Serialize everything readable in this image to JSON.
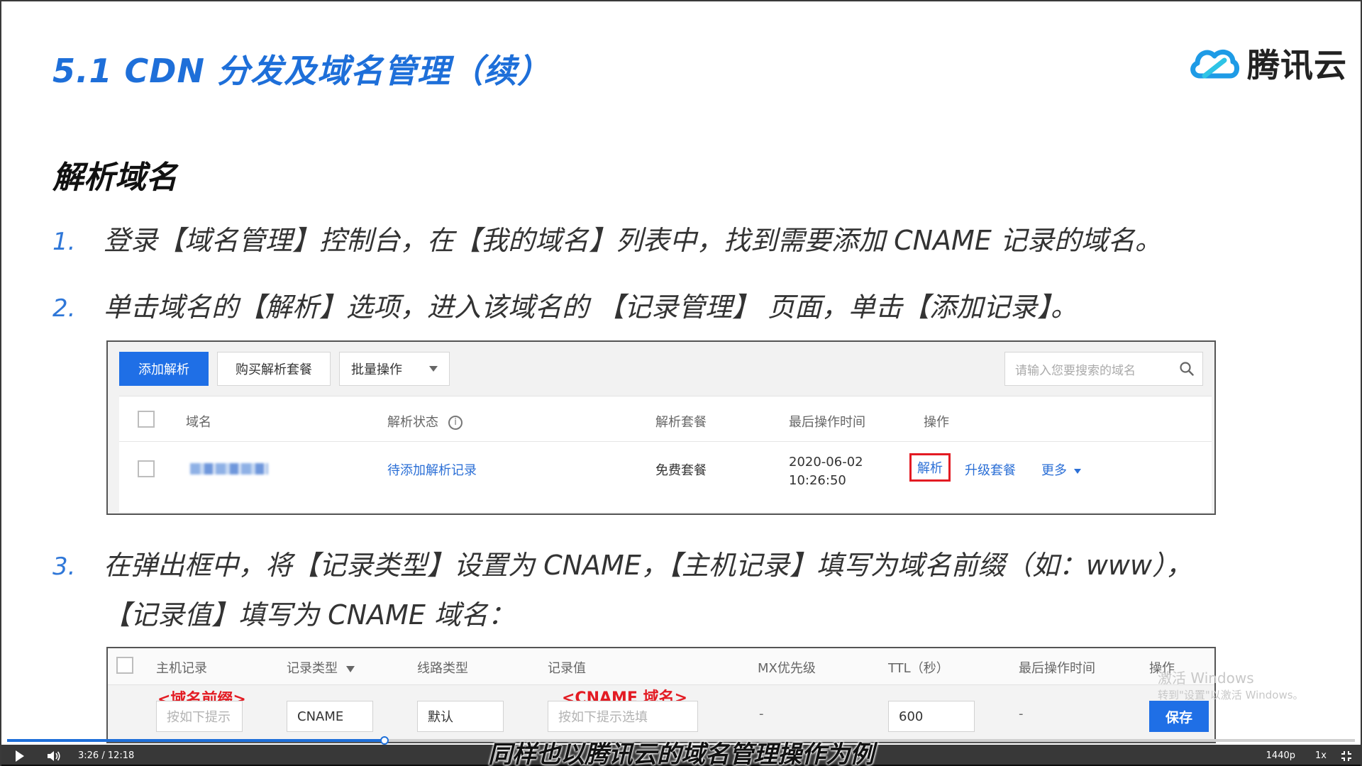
{
  "slide": {
    "title": "5.1 CDN 分发及域名管理（续）",
    "logo_text": "腾讯云",
    "section": "解析域名",
    "steps": [
      {
        "num": "1.",
        "text": "登录【域名管理】控制台，在【我的域名】列表中，找到需要添加 CNAME 记录的域名。"
      },
      {
        "num": "2.",
        "text": "单击域名的【解析】选项，进入该域名的 【记录管理】 页面，单击【添加记录】。"
      },
      {
        "num": "3.",
        "text": "在弹出框中，将【记录类型】设置为 CNAME，【主机记录】填写为域名前缀（如：www），",
        "text_cont": "【记录值】填写为 CNAME 域名："
      }
    ],
    "accent_color": "#1e6fd9"
  },
  "screenshot1": {
    "add_button": "添加解析",
    "buy_button": "购买解析套餐",
    "batch_select": "批量操作",
    "search_placeholder": "请输入您要搜索的域名",
    "headers": {
      "domain": "域名",
      "status": "解析状态",
      "plan": "解析套餐",
      "last_time": "最后操作时间",
      "actions": "操作"
    },
    "row": {
      "status": "待添加解析记录",
      "plan": "免费套餐",
      "date": "2020-06-02",
      "time": "10:26:50",
      "action_parse": "解析",
      "action_upgrade": "升级套餐",
      "action_more": "更多"
    }
  },
  "screenshot2": {
    "headers": {
      "host": "主机记录",
      "type": "记录类型",
      "line": "线路类型",
      "value": "记录值",
      "mx": "MX优先级",
      "ttl": "TTL（秒）",
      "last_time": "最后操作时间",
      "actions": "操作"
    },
    "annotations": {
      "host": "<域名前缀>",
      "value": "<CNAME 域名>"
    },
    "row": {
      "host_placeholder": "按如下提示",
      "type": "CNAME",
      "line": "默认",
      "value_placeholder": "按如下提示选填",
      "mx": "-",
      "ttl": "600",
      "last_time": "-",
      "save": "保存"
    }
  },
  "watermark": {
    "line1": "激活 Windows",
    "line2": "转到\"设置\"以激活 Windows。"
  },
  "player": {
    "time": "3:26 / 12:18",
    "quality": "1440p",
    "speed": "1x",
    "progress": 0.28,
    "caption": "同样也以腾讯云的域名管理操作为例"
  }
}
